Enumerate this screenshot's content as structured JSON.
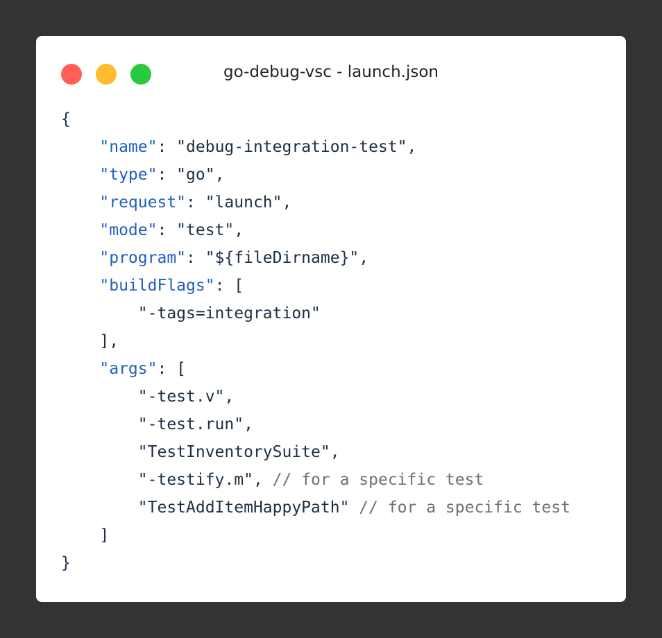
{
  "window": {
    "title": "go-debug-vsc - launch.json",
    "traffic_lights": [
      {
        "name": "close",
        "color": "#ff5f57"
      },
      {
        "name": "minimize",
        "color": "#febc2e"
      },
      {
        "name": "zoom",
        "color": "#28c840"
      }
    ]
  },
  "code": {
    "lines": [
      {
        "indent": "",
        "parts": [
          {
            "t": "{",
            "c": "punct"
          }
        ]
      },
      {
        "indent": "    ",
        "parts": [
          {
            "t": "\"name\"",
            "c": "key"
          },
          {
            "t": ": \"debug-integration-test\",",
            "c": "punct"
          }
        ]
      },
      {
        "indent": "    ",
        "parts": [
          {
            "t": "\"type\"",
            "c": "key"
          },
          {
            "t": ": \"go\",",
            "c": "punct"
          }
        ]
      },
      {
        "indent": "    ",
        "parts": [
          {
            "t": "\"request\"",
            "c": "key"
          },
          {
            "t": ": \"launch\",",
            "c": "punct"
          }
        ]
      },
      {
        "indent": "    ",
        "parts": [
          {
            "t": "\"mode\"",
            "c": "key"
          },
          {
            "t": ": \"test\",",
            "c": "punct"
          }
        ]
      },
      {
        "indent": "    ",
        "parts": [
          {
            "t": "\"program\"",
            "c": "key"
          },
          {
            "t": ": \"${fileDirname}\",",
            "c": "punct"
          }
        ]
      },
      {
        "indent": "    ",
        "parts": [
          {
            "t": "\"buildFlags\"",
            "c": "key"
          },
          {
            "t": ": [",
            "c": "punct"
          }
        ]
      },
      {
        "indent": "        ",
        "parts": [
          {
            "t": "\"-tags=integration\"",
            "c": "punct"
          }
        ]
      },
      {
        "indent": "    ",
        "parts": [
          {
            "t": "],",
            "c": "punct"
          }
        ]
      },
      {
        "indent": "    ",
        "parts": [
          {
            "t": "\"args\"",
            "c": "key"
          },
          {
            "t": ": [",
            "c": "punct"
          }
        ]
      },
      {
        "indent": "        ",
        "parts": [
          {
            "t": "\"-test.v\",",
            "c": "punct"
          }
        ]
      },
      {
        "indent": "        ",
        "parts": [
          {
            "t": "\"-test.run\",",
            "c": "punct"
          }
        ]
      },
      {
        "indent": "        ",
        "parts": [
          {
            "t": "\"TestInventorySuite\",",
            "c": "punct"
          }
        ]
      },
      {
        "indent": "        ",
        "parts": [
          {
            "t": "\"-testify.m\", ",
            "c": "punct"
          },
          {
            "t": "// for a specific test",
            "c": "comment"
          }
        ]
      },
      {
        "indent": "        ",
        "parts": [
          {
            "t": "\"TestAddItemHappyPath\" ",
            "c": "punct"
          },
          {
            "t": "// for a specific test",
            "c": "comment"
          }
        ]
      },
      {
        "indent": "    ",
        "parts": [
          {
            "t": "]",
            "c": "punct"
          }
        ]
      },
      {
        "indent": "",
        "parts": [
          {
            "t": "}",
            "c": "punct"
          }
        ]
      }
    ]
  }
}
